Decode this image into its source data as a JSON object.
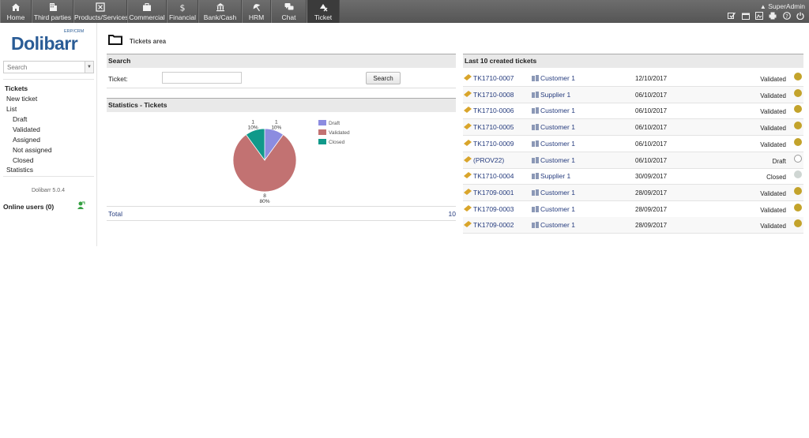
{
  "nav": {
    "tabs": [
      {
        "label": "Home",
        "icon": "home-icon"
      },
      {
        "label": "Third parties",
        "icon": "building-icon"
      },
      {
        "label": "Products/Services",
        "icon": "box-icon"
      },
      {
        "label": "Commercial",
        "icon": "briefcase-icon"
      },
      {
        "label": "Financial",
        "icon": "dollar-icon"
      },
      {
        "label": "Bank/Cash",
        "icon": "bank-icon"
      },
      {
        "label": "HRM",
        "icon": "umbrella-icon"
      },
      {
        "label": "Chat",
        "icon": "chat-icon"
      },
      {
        "label": "Ticket",
        "icon": "ticket-icon"
      }
    ],
    "active_tab": "Ticket",
    "user": "SuperAdmin"
  },
  "logo": {
    "text": "Dolibarr",
    "sub": "ERP/CRM"
  },
  "leftmenu": {
    "search_placeholder": "Search",
    "items": {
      "tickets": "Tickets",
      "new_ticket": "New ticket",
      "list": "List",
      "draft": "Draft",
      "validated": "Validated",
      "assigned": "Assigned",
      "not_assigned": "Not assigned",
      "closed": "Closed",
      "statistics": "Statistics"
    },
    "version": "Dolibarr 5.0.4",
    "online_users": "Online users (0)"
  },
  "page": {
    "title": "Tickets area"
  },
  "search": {
    "title": "Search",
    "label": "Ticket:",
    "button": "Search"
  },
  "statistics": {
    "title": "Statistics - Tickets",
    "total_label": "Total",
    "total_value": "10"
  },
  "chart_data": {
    "type": "pie",
    "categories": [
      "Draft",
      "Validated",
      "Closed"
    ],
    "values": [
      1,
      8,
      1
    ],
    "labels_pct": [
      "10%",
      "80%",
      "10%"
    ],
    "colors": [
      "#8c8ce0",
      "#c27272",
      "#10998a"
    ],
    "legend": "right"
  },
  "tickets": {
    "title": "Last 10 created tickets",
    "rows": [
      {
        "ref": "TK1710-0007",
        "customer": "Customer 1",
        "date": "12/10/2017",
        "status": "Validated",
        "state": "validated"
      },
      {
        "ref": "TK1710-0008",
        "customer": "Supplier 1",
        "date": "06/10/2017",
        "status": "Validated",
        "state": "validated"
      },
      {
        "ref": "TK1710-0006",
        "customer": "Customer 1",
        "date": "06/10/2017",
        "status": "Validated",
        "state": "validated"
      },
      {
        "ref": "TK1710-0005",
        "customer": "Customer 1",
        "date": "06/10/2017",
        "status": "Validated",
        "state": "validated"
      },
      {
        "ref": "TK1710-0009",
        "customer": "Customer 1",
        "date": "06/10/2017",
        "status": "Validated",
        "state": "validated"
      },
      {
        "ref": "(PROV22)",
        "customer": "Customer 1",
        "date": "06/10/2017",
        "status": "Draft",
        "state": "draft"
      },
      {
        "ref": "TK1710-0004",
        "customer": "Supplier 1",
        "date": "30/09/2017",
        "status": "Closed",
        "state": "closed"
      },
      {
        "ref": "TK1709-0001",
        "customer": "Customer 1",
        "date": "28/09/2017",
        "status": "Validated",
        "state": "validated"
      },
      {
        "ref": "TK1709-0003",
        "customer": "Customer 1",
        "date": "28/09/2017",
        "status": "Validated",
        "state": "validated"
      },
      {
        "ref": "TK1709-0002",
        "customer": "Customer 1",
        "date": "28/09/2017",
        "status": "Validated",
        "state": "validated"
      }
    ]
  },
  "colors": {
    "validated": "#c3a32b",
    "draft": "#ffffff",
    "closed": "#cfd6d3",
    "link": "#263c7e"
  }
}
